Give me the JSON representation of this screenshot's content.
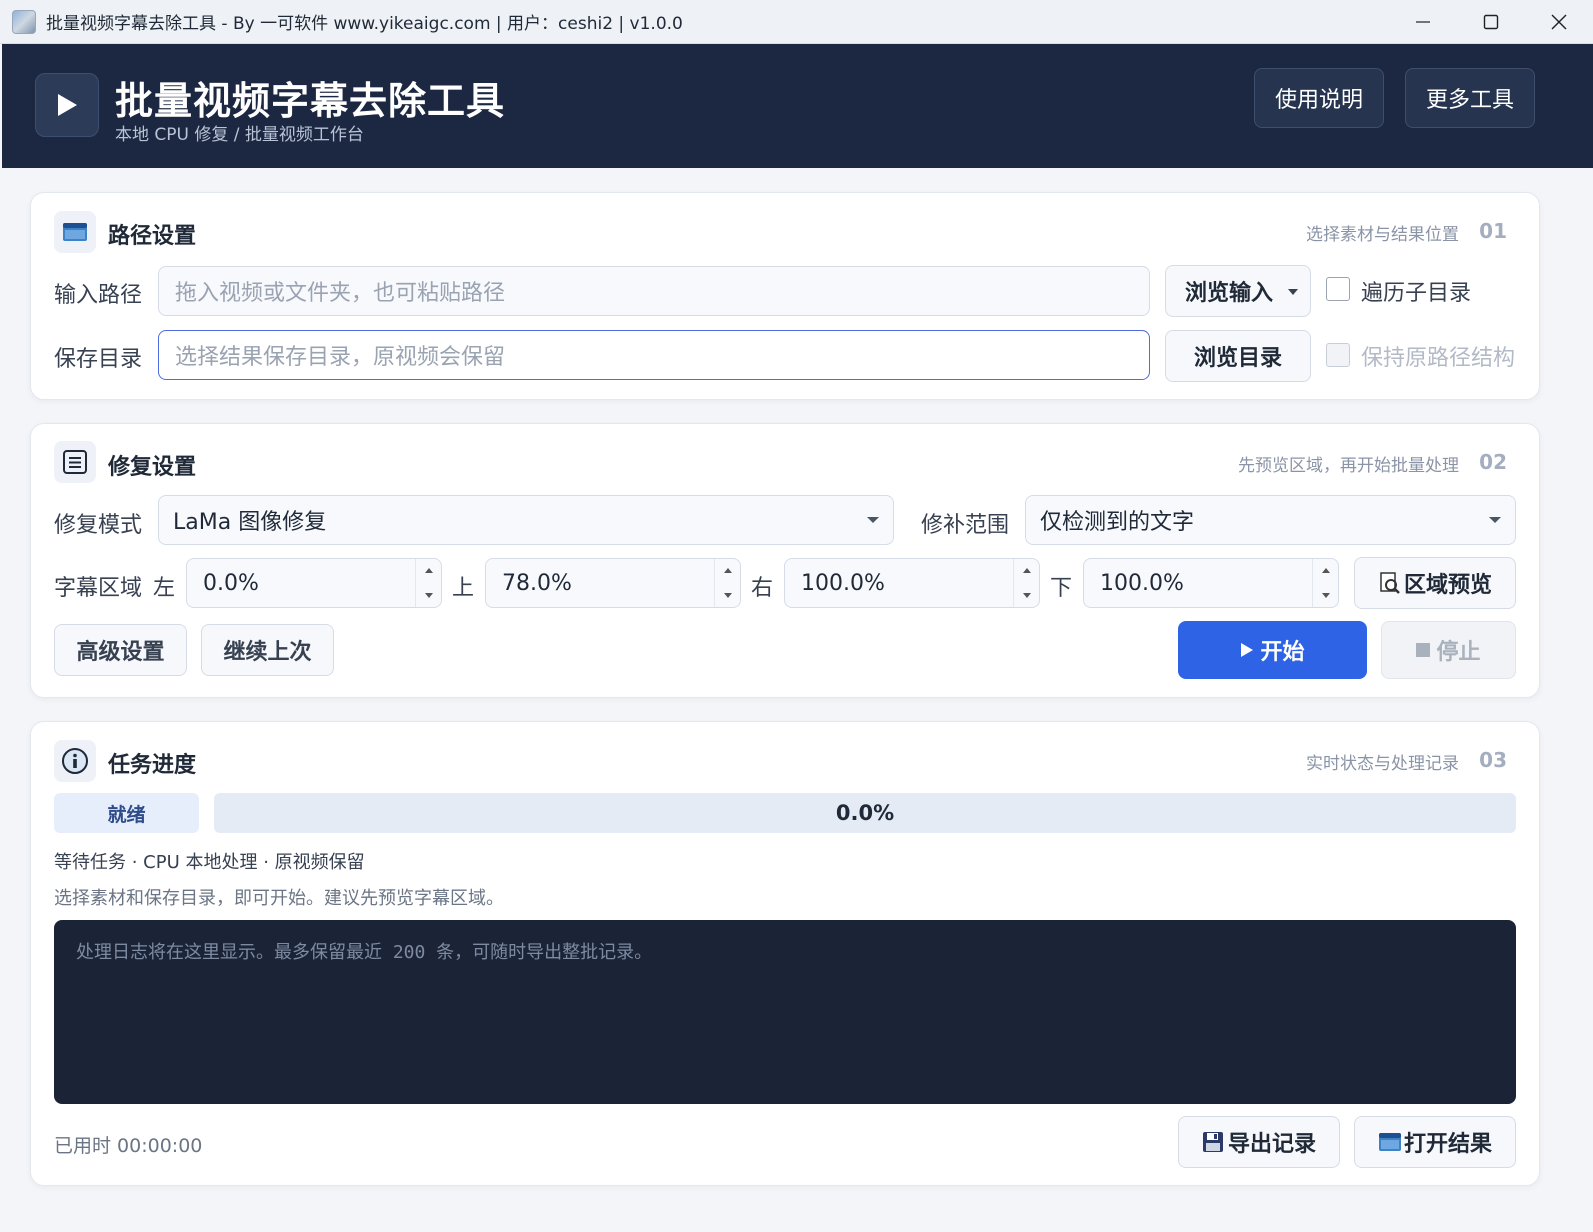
{
  "window": {
    "title": "批量视频字幕去除工具 - By 一可软件 www.yikeaigc.com | 用户：ceshi2 | v1.0.0"
  },
  "header": {
    "title": "批量视频字幕去除工具",
    "subtitle": "本地 CPU 修复  /  批量视频工作台",
    "help_label": "使用说明",
    "more_label": "更多工具"
  },
  "path_settings": {
    "title": "路径设置",
    "hint": "选择素材与结果位置",
    "num": "01",
    "input_label": "输入路径",
    "input_placeholder": "拖入视频或文件夹，也可粘贴路径",
    "browse_input_label": "浏览输入",
    "recursive_label": "遍历子目录",
    "save_label": "保存目录",
    "save_placeholder": "选择结果保存目录，原视频会保留",
    "browse_dir_label": "浏览目录",
    "keep_structure_label": "保持原路径结构"
  },
  "repair_settings": {
    "title": "修复设置",
    "hint": "先预览区域，再开始批量处理",
    "num": "02",
    "mode_label": "修复模式",
    "mode_value": "LaMa 图像修复",
    "scope_label": "修补范围",
    "scope_value": "仅检测到的文字",
    "region_label": "字幕区域",
    "left_label": "左",
    "left_value": "0.0%",
    "top_label": "上",
    "top_value": "78.0%",
    "right_label": "右",
    "right_value": "100.0%",
    "bottom_label": "下",
    "bottom_value": "100.0%",
    "preview_label": "区域预览",
    "advanced_label": "高级设置",
    "resume_label": "继续上次",
    "start_label": "开始",
    "stop_label": "停止"
  },
  "progress": {
    "title": "任务进度",
    "hint": "实时状态与处理记录",
    "num": "03",
    "status": "就绪",
    "percent_text": "0.0%",
    "percent": 0.0,
    "meta": "等待任务  ·  CPU 本地处理  ·  原视频保留",
    "tip": "选择素材和保存目录，即可开始。建议先预览字幕区域。",
    "log_placeholder": "处理日志将在这里显示。最多保留最近 200 条，可随时导出整批记录。",
    "elapsed": "已用时 00:00:00",
    "export_label": "导出记录",
    "open_label": "打开结果"
  },
  "colors": {
    "header_bg": "#1c2841",
    "primary": "#2e63e6",
    "log_bg": "#1b2437"
  }
}
